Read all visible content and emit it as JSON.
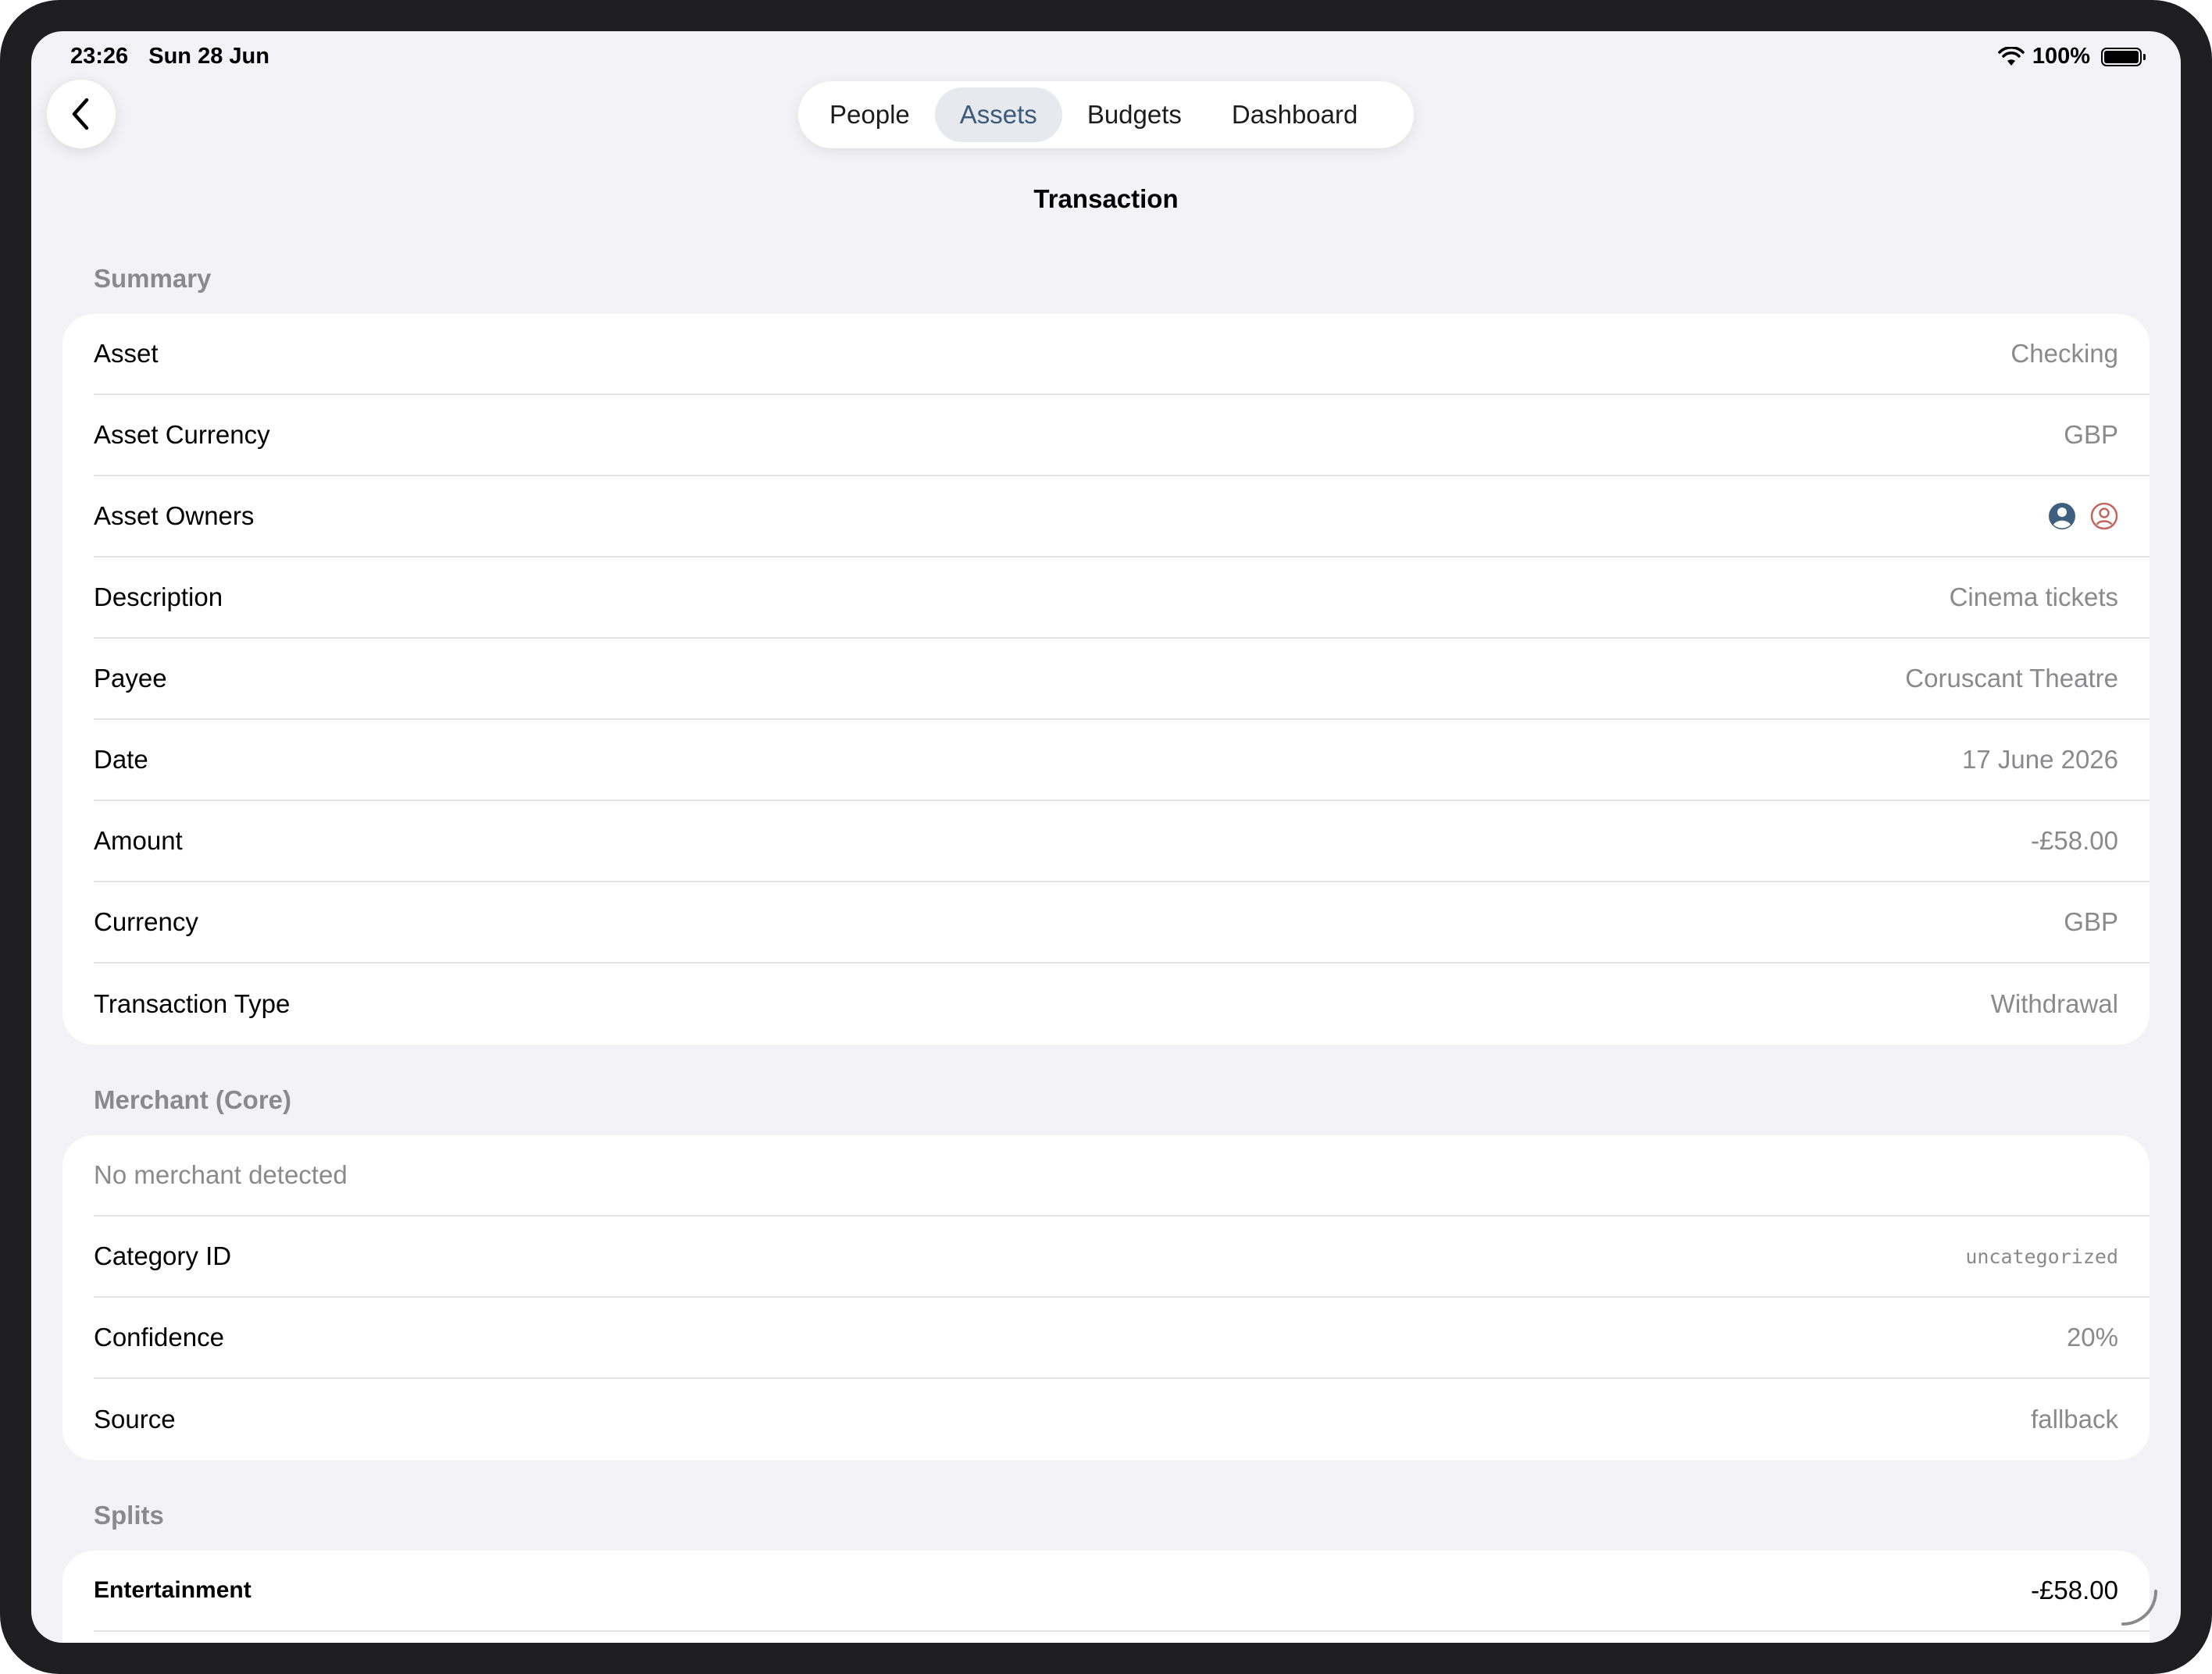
{
  "status_bar": {
    "time": "23:26",
    "date": "Sun 28 Jun",
    "battery": "100%"
  },
  "nav": {
    "tabs": [
      {
        "label": "People"
      },
      {
        "label": "Assets"
      },
      {
        "label": "Budgets"
      },
      {
        "label": "Dashboard"
      }
    ],
    "active_tab": "Assets",
    "title": "Transaction"
  },
  "summary": {
    "header": "Summary",
    "rows": [
      {
        "label": "Asset",
        "value": "Checking"
      },
      {
        "label": "Asset Currency",
        "value": "GBP"
      },
      {
        "label": "Asset Owners",
        "value": ""
      },
      {
        "label": "Description",
        "value": "Cinema tickets"
      },
      {
        "label": "Payee",
        "value": "Coruscant Theatre"
      },
      {
        "label": "Date",
        "value": "17 June 2026"
      },
      {
        "label": "Amount",
        "value": "-£58.00"
      },
      {
        "label": "Currency",
        "value": "GBP"
      },
      {
        "label": "Transaction Type",
        "value": "Withdrawal"
      }
    ],
    "owner_icons": [
      {
        "icon": "person-circle-filled-icon",
        "color": "#3f5f7f"
      },
      {
        "icon": "person-circle-outline-icon",
        "color": "#c0675f"
      }
    ]
  },
  "merchant": {
    "header": "Merchant (Core)",
    "status": "No merchant detected",
    "rows": [
      {
        "label": "Category ID",
        "value": "uncategorized"
      },
      {
        "label": "Confidence",
        "value": "20%"
      },
      {
        "label": "Source",
        "value": "fallback"
      }
    ]
  },
  "splits": {
    "header": "Splits",
    "items": [
      {
        "label": "Entertainment",
        "value": "-£58.00"
      }
    ]
  },
  "colors": {
    "accent": "#3c5a7a",
    "background": "#f2f2f7",
    "secondary_text": "#8a8a8e"
  }
}
